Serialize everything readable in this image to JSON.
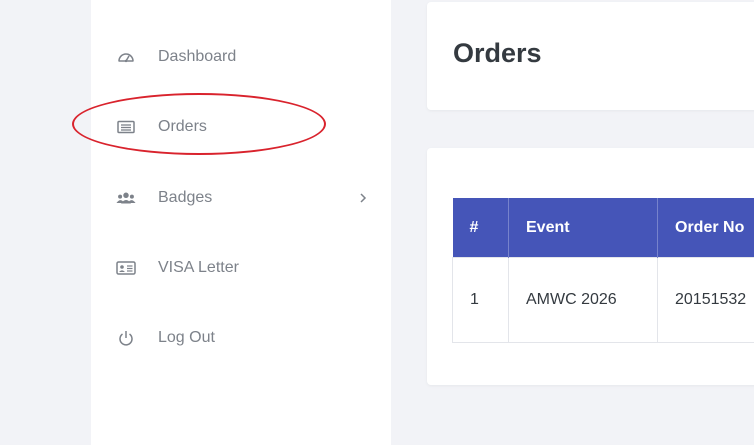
{
  "sidebar": {
    "items": [
      {
        "label": "Dashboard",
        "icon": "dashboard-gauge-icon"
      },
      {
        "label": "Orders",
        "icon": "orders-list-icon",
        "highlighted": true
      },
      {
        "label": "Badges",
        "icon": "users-group-icon",
        "has_submenu": true
      },
      {
        "label": "VISA Letter",
        "icon": "id-card-icon"
      },
      {
        "label": "Log Out",
        "icon": "power-icon"
      }
    ]
  },
  "header": {
    "title": "Orders"
  },
  "orders_table": {
    "columns": [
      "#",
      "Event",
      "Order No"
    ],
    "rows": [
      {
        "num": "1",
        "event": "AMWC 2026",
        "order_no": "20151532"
      }
    ]
  },
  "colors": {
    "table_header_bg": "#4555b8",
    "highlight_annotation": "#d9232d",
    "page_bg": "#f2f3f7",
    "card_bg": "#ffffff",
    "nav_text": "#7d828a"
  }
}
